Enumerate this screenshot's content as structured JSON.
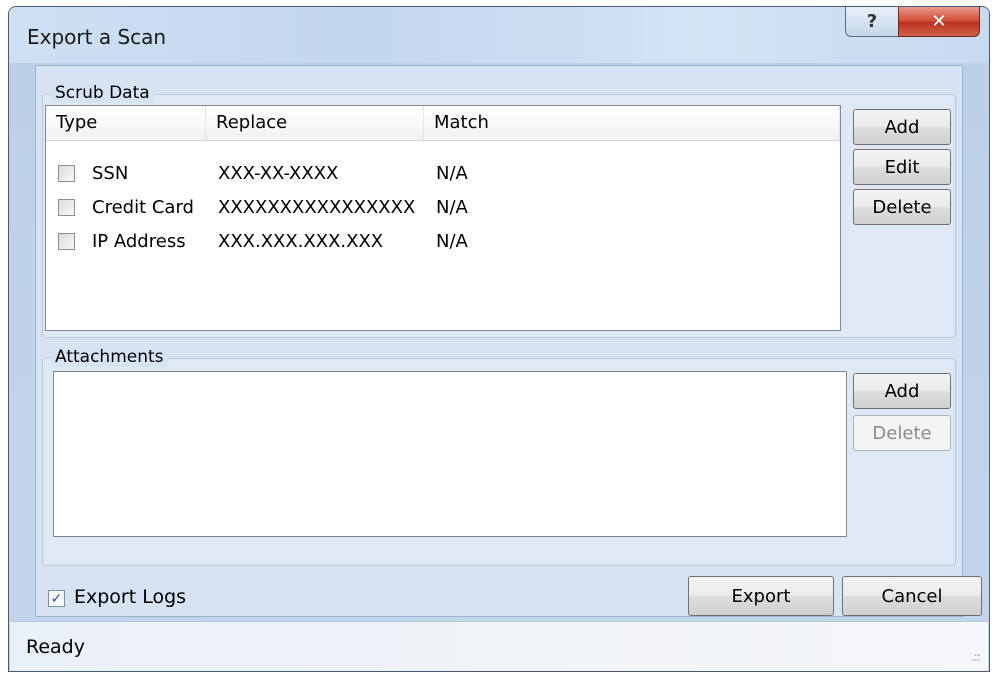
{
  "window": {
    "title": "Export a Scan",
    "help_glyph": "?",
    "close_glyph": "✕"
  },
  "scrub": {
    "label": "Scrub Data",
    "columns": [
      "Type",
      "Replace",
      "Match"
    ],
    "rows": [
      {
        "type": "SSN",
        "replace": "XXX-XX-XXXX",
        "match": "N/A",
        "checked": false
      },
      {
        "type": "Credit Card",
        "replace": "XXXXXXXXXXXXXXXX",
        "match": "N/A",
        "checked": false
      },
      {
        "type": "IP Address",
        "replace": "XXX.XXX.XXX.XXX",
        "match": "N/A",
        "checked": false
      }
    ],
    "add_label": "Add",
    "edit_label": "Edit",
    "delete_label": "Delete"
  },
  "attachments": {
    "label": "Attachments",
    "add_label": "Add",
    "delete_label": "Delete"
  },
  "footer": {
    "export_logs_label": "Export Logs",
    "export_logs_checked": true,
    "export_label": "Export",
    "cancel_label": "Cancel"
  },
  "status": {
    "text": "Ready",
    "grip_glyph": ".::"
  },
  "icons": {
    "help": "help-icon",
    "close": "close-icon",
    "checkbox": "checkbox-icon",
    "resize_grip": "resize-grip-icon"
  }
}
